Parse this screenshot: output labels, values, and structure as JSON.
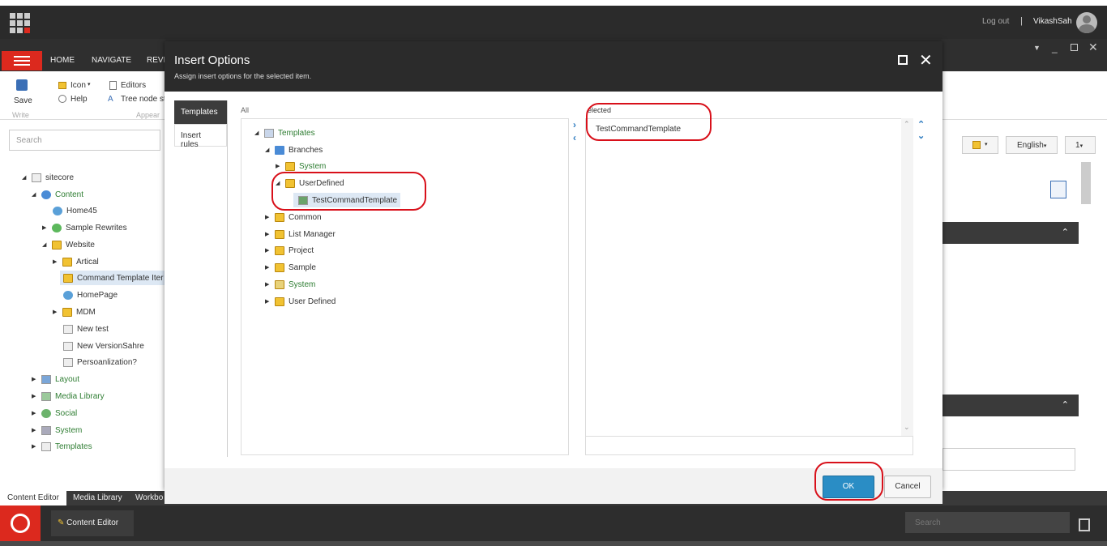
{
  "header": {
    "logout": "Log out",
    "separator": "|",
    "username": "VikashSah"
  },
  "ribbon": {
    "tabs": [
      "HOME",
      "NAVIGATE",
      "REVI"
    ],
    "save": "Save",
    "write": "Write",
    "icon": "Icon",
    "help": "Help",
    "editors": "Editors",
    "tree_node": "Tree node st",
    "appear": "Appear"
  },
  "left": {
    "search_placeholder": "Search",
    "tree": [
      {
        "label": "sitecore"
      },
      {
        "label": "Content"
      },
      {
        "label": "Home45"
      },
      {
        "label": "Sample Rewrites"
      },
      {
        "label": "Website"
      },
      {
        "label": "Artical"
      },
      {
        "label": "Command Template Iter"
      },
      {
        "label": "HomePage"
      },
      {
        "label": "MDM"
      },
      {
        "label": "New test"
      },
      {
        "label": "New VersionSahre"
      },
      {
        "label": "Persoanlization?"
      },
      {
        "label": "Layout"
      },
      {
        "label": "Media Library"
      },
      {
        "label": "Social"
      },
      {
        "label": "System"
      },
      {
        "label": "Templates"
      }
    ]
  },
  "right": {
    "lang": "English",
    "version": "1"
  },
  "bottom_tabs": [
    "Content Editor",
    "Media Library",
    "Workbo"
  ],
  "taskbar": {
    "app": "Content Editor",
    "search_placeholder": "Search"
  },
  "dialog": {
    "title": "Insert Options",
    "subtitle": "Assign insert options for the selected item.",
    "tabs": [
      "Templates",
      "Insert rules"
    ],
    "all_label": "All",
    "selected_label": "elected",
    "tree": [
      {
        "label": "Templates"
      },
      {
        "label": "Branches"
      },
      {
        "label": "System"
      },
      {
        "label": "UserDefined"
      },
      {
        "label": "TestCommandTemplate"
      },
      {
        "label": "Common"
      },
      {
        "label": "List Manager"
      },
      {
        "label": "Project"
      },
      {
        "label": "Sample"
      },
      {
        "label": "System"
      },
      {
        "label": "User Defined"
      }
    ],
    "selected_items": [
      "TestCommandTemplate"
    ],
    "ok": "OK",
    "cancel": "Cancel"
  }
}
